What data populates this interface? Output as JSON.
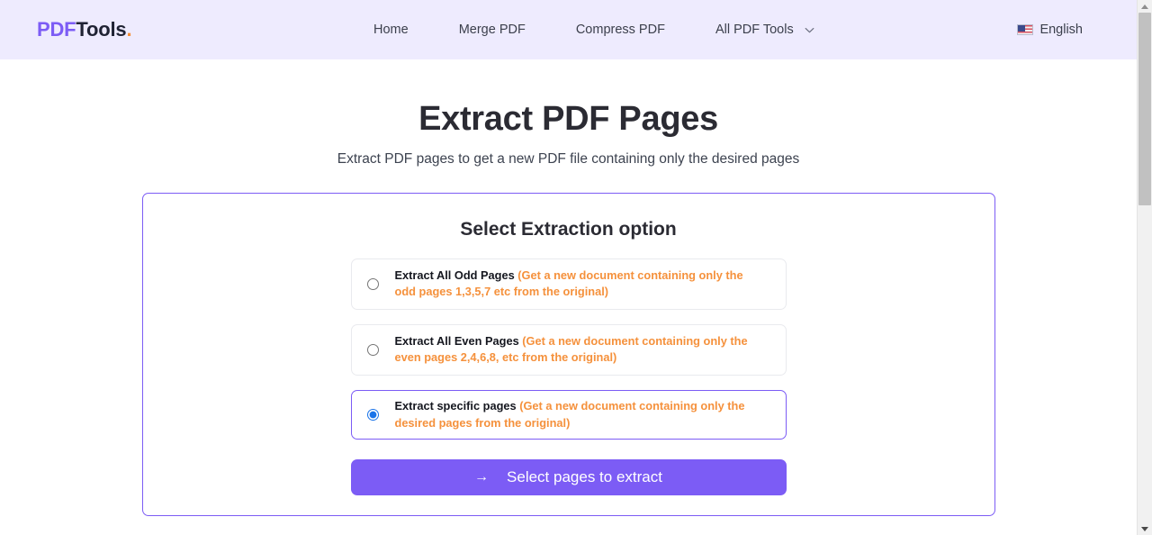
{
  "header": {
    "logo": {
      "part1": "PDF",
      "part2": "Tools",
      "dot": "."
    },
    "nav": [
      {
        "label": "Home",
        "name": "nav-home"
      },
      {
        "label": "Merge PDF",
        "name": "nav-merge-pdf"
      },
      {
        "label": "Compress PDF",
        "name": "nav-compress-pdf"
      },
      {
        "label": "All PDF Tools",
        "name": "nav-all-pdf-tools",
        "has_chevron": true
      }
    ],
    "language": {
      "label": "English",
      "flag": "us-flag-icon"
    },
    "background": "#eeebfe"
  },
  "hero": {
    "title": "Extract PDF Pages",
    "subtitle": "Extract PDF pages to get a new PDF file containing only the desired pages"
  },
  "panel": {
    "title": "Select Extraction option",
    "border_color": "#7c5cf5",
    "options": [
      {
        "label": "Extract All Odd Pages",
        "hint": "(Get a new document containing only the odd pages 1,3,5,7 etc from the original)",
        "selected": false
      },
      {
        "label": "Extract All Even Pages",
        "hint": "(Get a new document containing only the even pages 2,4,6,8, etc from the original)",
        "selected": false
      },
      {
        "label": "Extract specific pages",
        "hint": "(Get a new document containing only the desired pages from the original)",
        "selected": true
      }
    ],
    "cta": {
      "arrow": "→",
      "label": "Select pages to extract",
      "color": "#7c5cf5"
    }
  },
  "colors": {
    "accent_purple": "#7c5cf5",
    "hint_orange": "#f5913c",
    "logo_dot_orange": "#f59038",
    "header_bg": "#eeebfe"
  }
}
